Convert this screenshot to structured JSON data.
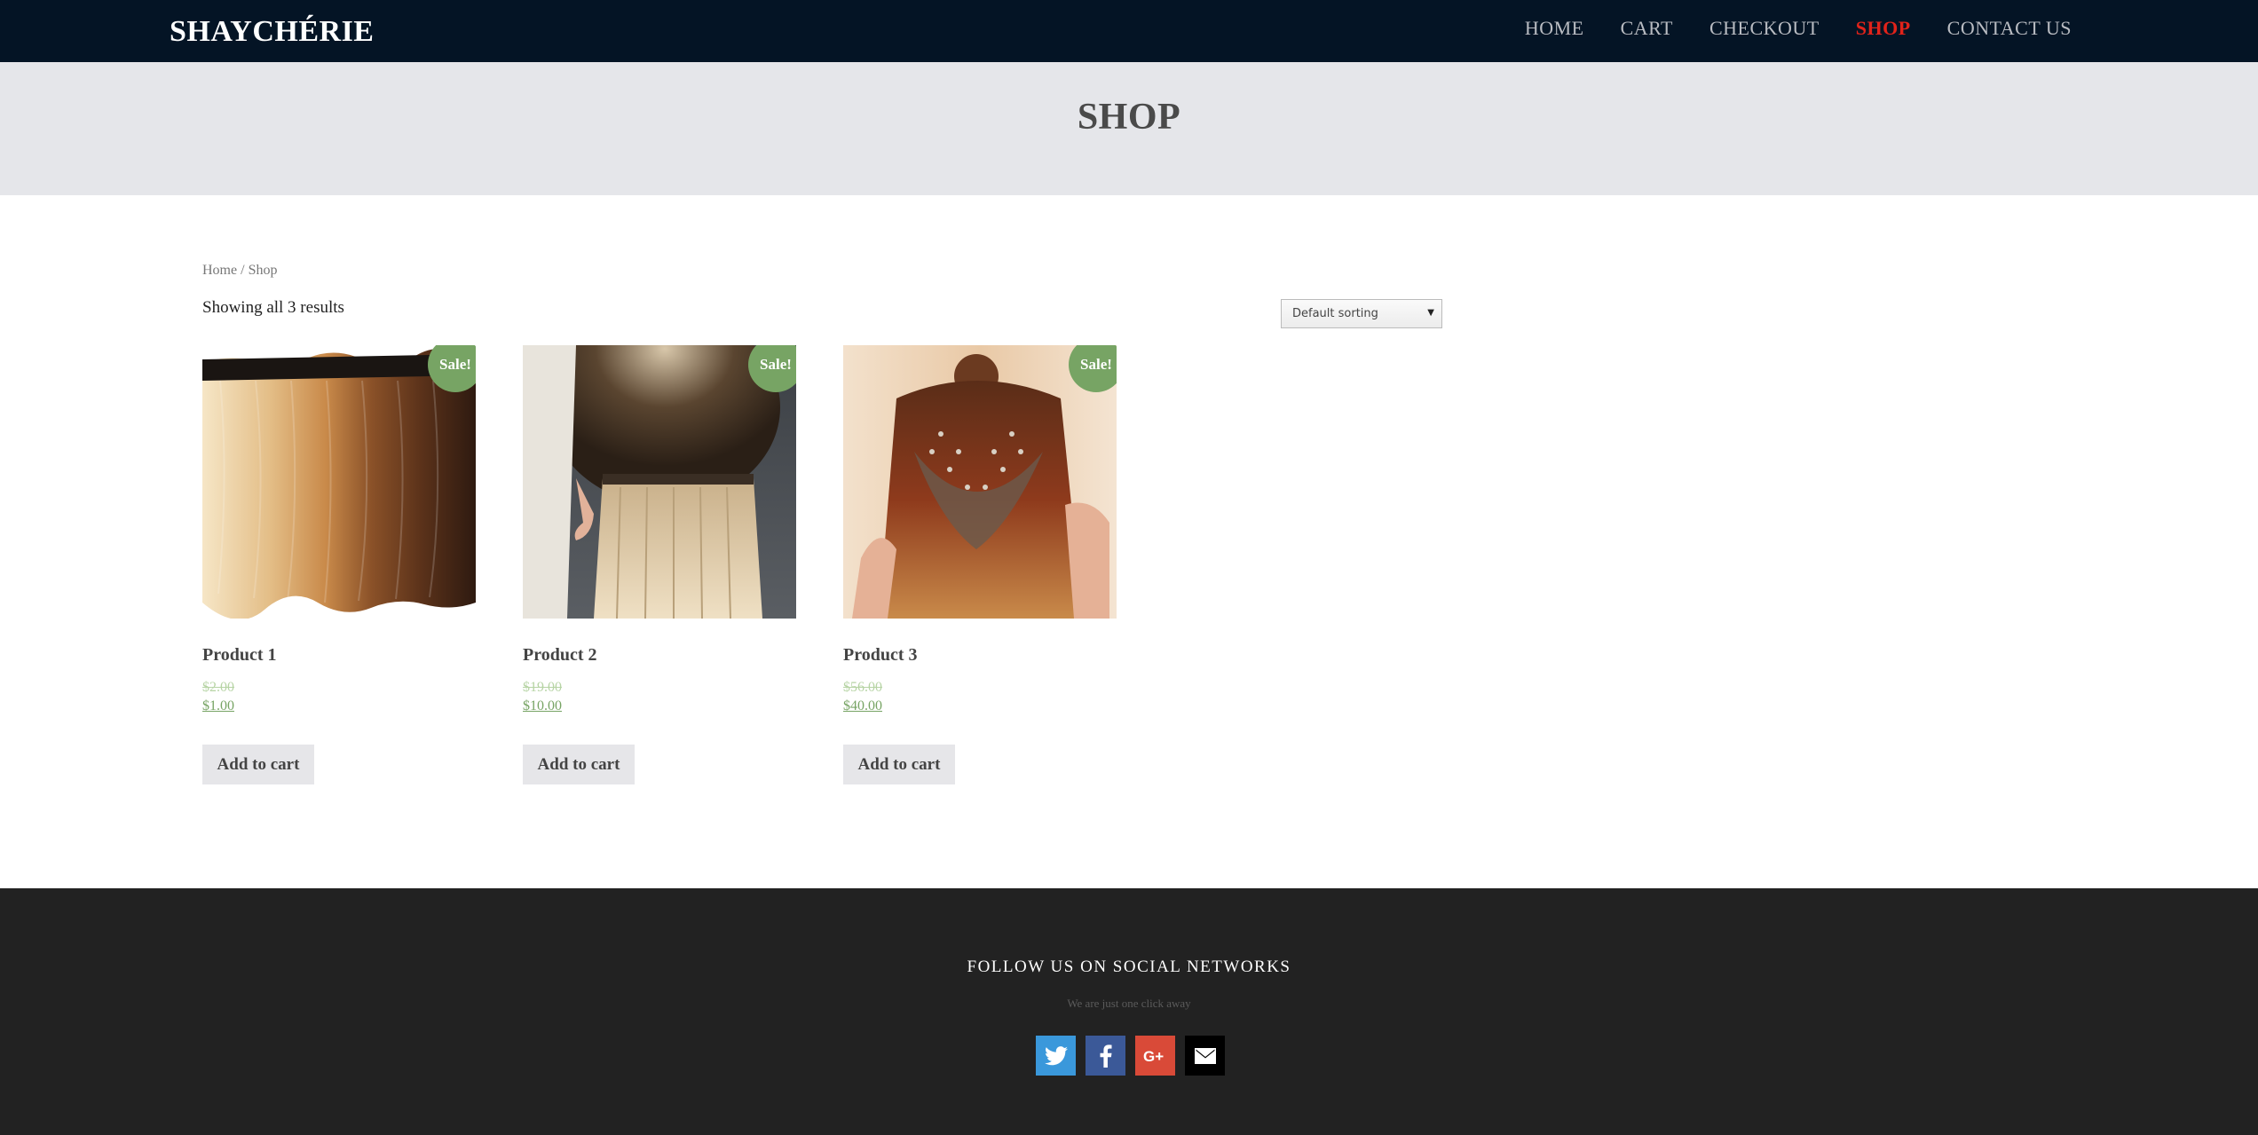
{
  "header": {
    "logo": "SHAYCHÉRIE",
    "nav": [
      {
        "label": "HOME"
      },
      {
        "label": "CART"
      },
      {
        "label": "CHECKOUT"
      },
      {
        "label": "SHOP"
      },
      {
        "label": "CONTACT US"
      }
    ],
    "active": "SHOP",
    "accent_color": "#e2231a"
  },
  "page": {
    "title": "SHOP"
  },
  "breadcrumb": {
    "home": "Home",
    "separator": " / ",
    "current": "Shop"
  },
  "results": {
    "count_text": "Showing all 3 results"
  },
  "sorting": {
    "selected": "Default sorting"
  },
  "products": [
    {
      "name": "Product 1",
      "old_price": "$2.00",
      "price": "$1.00",
      "badge": "Sale!",
      "button": "Add to cart",
      "image": "hair-swatches-image"
    },
    {
      "name": "Product 2",
      "old_price": "$19.00",
      "price": "$10.00",
      "badge": "Sale!",
      "button": "Add to cart",
      "image": "blonde-extensions-image"
    },
    {
      "name": "Product 3",
      "old_price": "$56.00",
      "price": "$40.00",
      "badge": "Sale!",
      "button": "Add to cart",
      "image": "hair-extension-install-image"
    }
  ],
  "footer": {
    "heading": "FOLLOW US ON SOCIAL NETWORKS",
    "tagline": "We are just one click away",
    "socials": [
      {
        "icon": "twitter-icon",
        "color": "#3a98db"
      },
      {
        "icon": "facebook-icon",
        "color": "#3b5998"
      },
      {
        "icon": "google-plus-icon",
        "color": "#d94a38"
      },
      {
        "icon": "email-icon",
        "color": "#000000"
      }
    ]
  },
  "colors": {
    "sale_badge": "#77a464",
    "header_bg": "#041425",
    "footer_bg": "#222222"
  }
}
